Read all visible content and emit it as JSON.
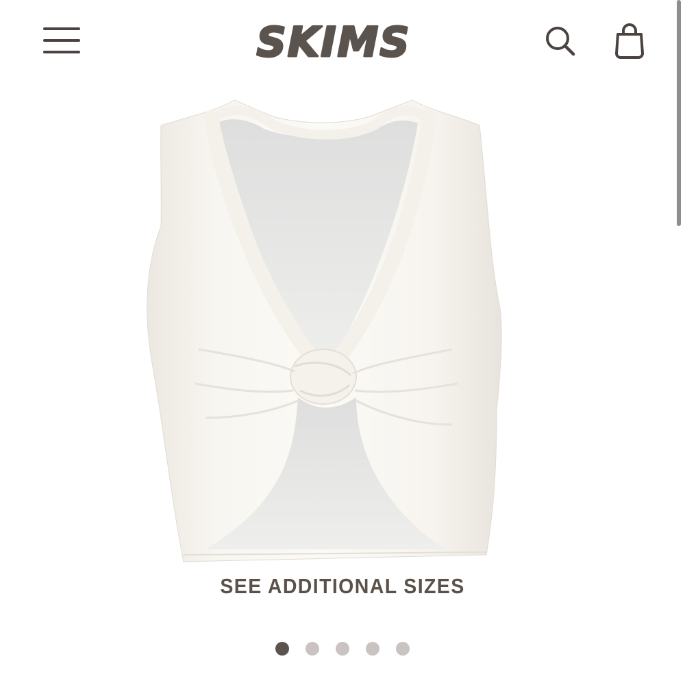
{
  "header": {
    "logo_text": "SKIMS",
    "menu_icon": "hamburger-menu-icon",
    "search_icon": "search-icon",
    "bag_icon": "shopping-bag-icon"
  },
  "product": {
    "image_icon": "product-image"
  },
  "see_sizes_label": "SEE ADDITIONAL SIZES",
  "carousel": {
    "total": 5,
    "active_index": 0
  },
  "colors": {
    "brand": "#5b534d",
    "text": "#5a524a",
    "dot_inactive": "#c9c4c1",
    "icon": "#4a4340"
  }
}
